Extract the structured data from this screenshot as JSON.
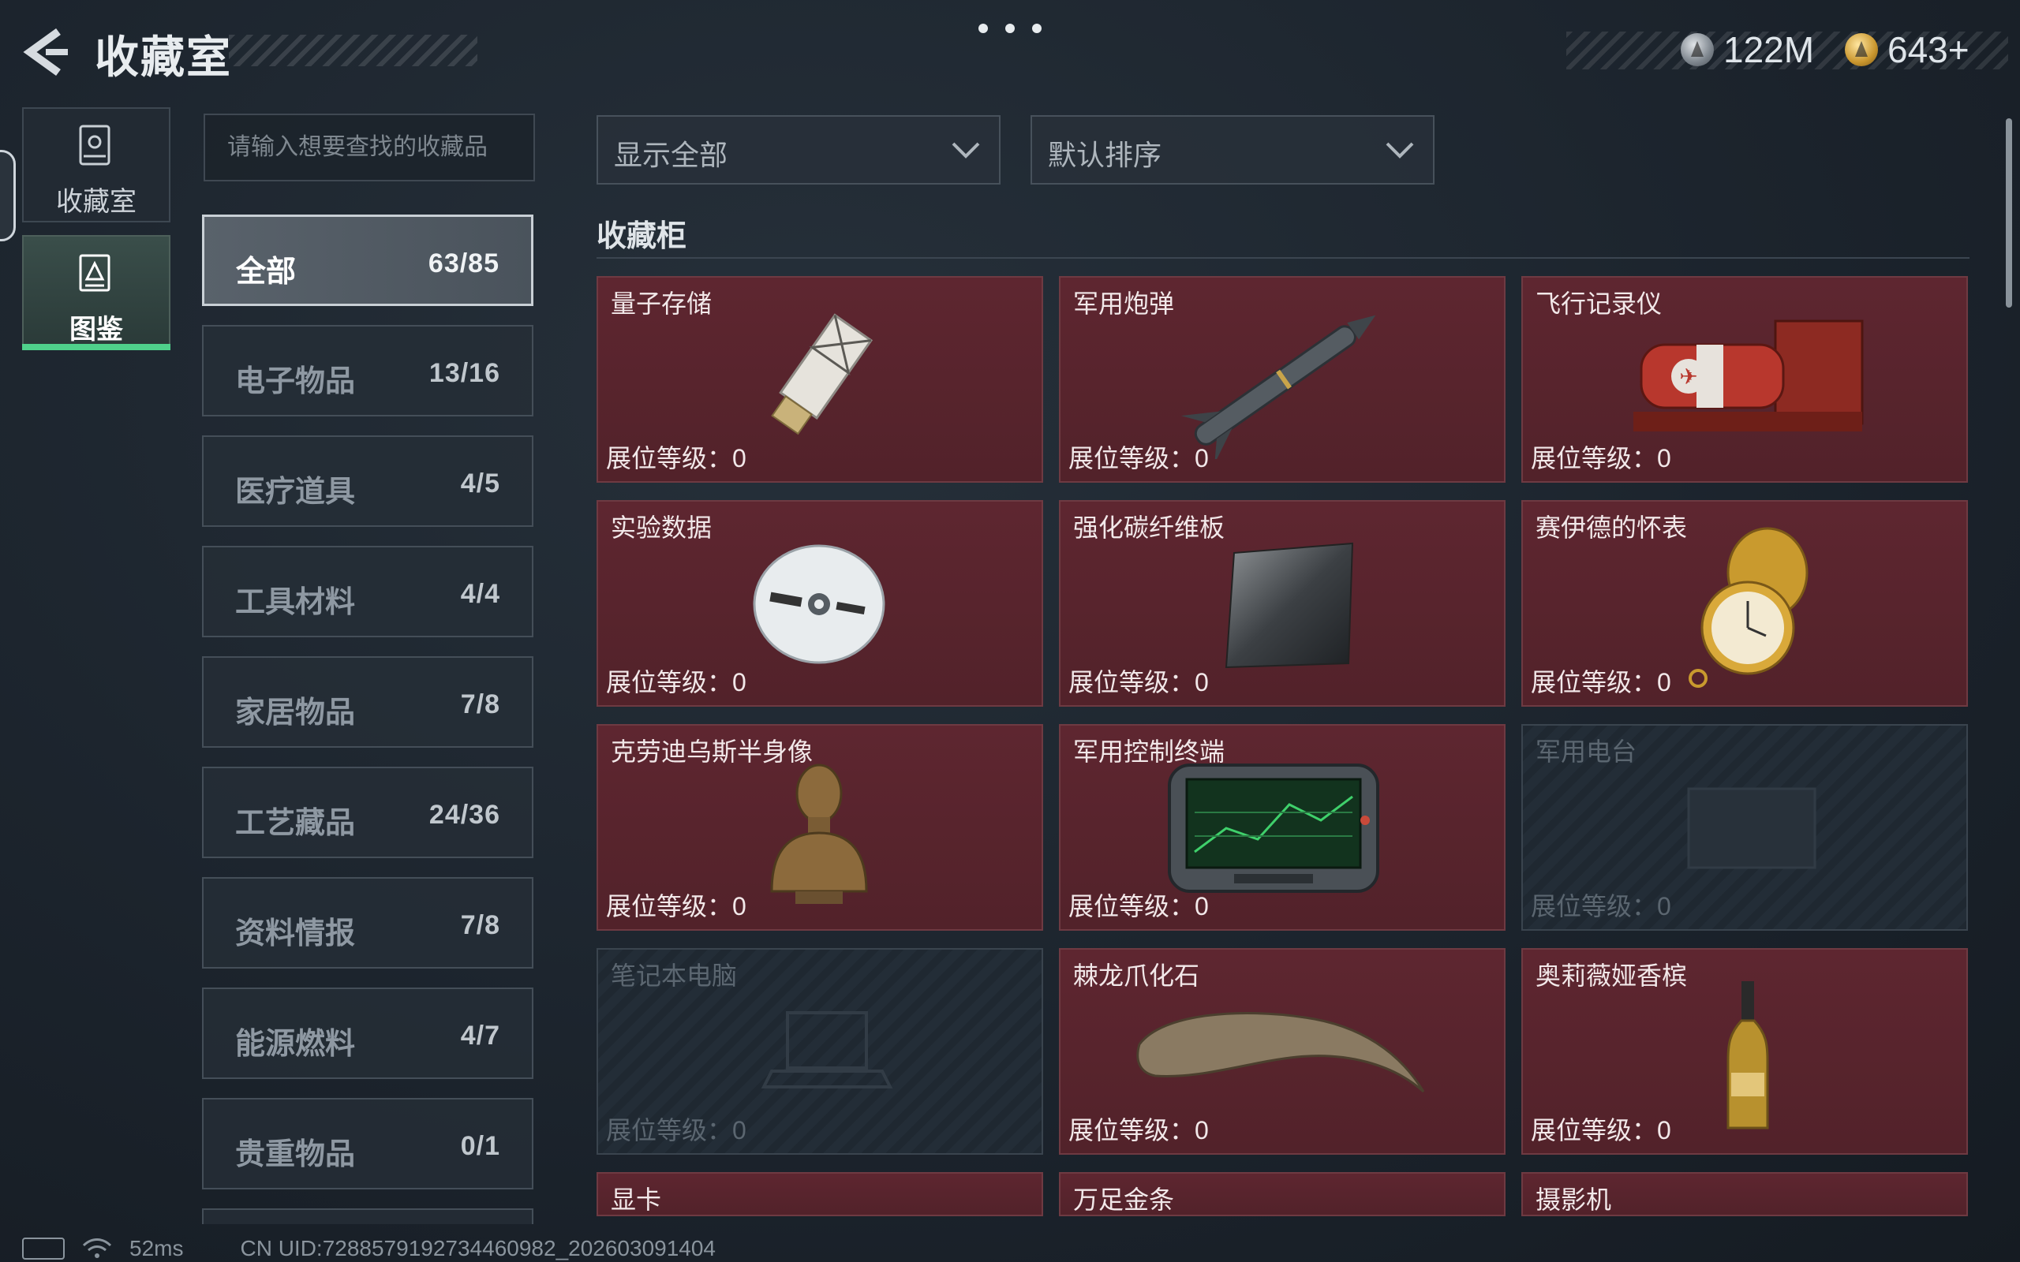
{
  "header": {
    "title": "收藏室"
  },
  "currency": {
    "silver": "122M",
    "gold": "643+"
  },
  "left_nav": [
    {
      "label": "收藏室",
      "active": false
    },
    {
      "label": "图鉴",
      "active": true
    }
  ],
  "search": {
    "placeholder": "请输入想要查找的收藏品"
  },
  "filters": {
    "display": "显示全部",
    "sort": "默认排序"
  },
  "categories": [
    {
      "name": "全部",
      "count": "63/85",
      "active": true
    },
    {
      "name": "电子物品",
      "count": "13/16"
    },
    {
      "name": "医疗道具",
      "count": "4/5"
    },
    {
      "name": "工具材料",
      "count": "4/4"
    },
    {
      "name": "家居物品",
      "count": "7/8"
    },
    {
      "name": "工艺藏品",
      "count": "24/36"
    },
    {
      "name": "资料情报",
      "count": "7/8"
    },
    {
      "name": "能源燃料",
      "count": "4/7"
    },
    {
      "name": "贵重物品",
      "count": "0/1"
    }
  ],
  "cabinet": {
    "title": "收藏柜",
    "items": [
      {
        "name": "量子存储",
        "level": "展位等级：0",
        "unlocked": true,
        "icon": "usb-drive-icon"
      },
      {
        "name": "军用炮弹",
        "level": "展位等级：0",
        "unlocked": true,
        "icon": "missile-icon"
      },
      {
        "name": "飞行记录仪",
        "level": "展位等级：0",
        "unlocked": true,
        "icon": "flight-recorder-icon"
      },
      {
        "name": "实验数据",
        "level": "展位等级：0",
        "unlocked": true,
        "icon": "disc-icon"
      },
      {
        "name": "强化碳纤维板",
        "level": "展位等级：0",
        "unlocked": true,
        "icon": "carbon-plate-icon"
      },
      {
        "name": "赛伊德的怀表",
        "level": "展位等级：0",
        "unlocked": true,
        "icon": "pocket-watch-icon"
      },
      {
        "name": "克劳迪乌斯半身像",
        "level": "展位等级：0",
        "unlocked": true,
        "icon": "bust-statue-icon"
      },
      {
        "name": "军用控制终端",
        "level": "展位等级：0",
        "unlocked": true,
        "icon": "control-terminal-icon"
      },
      {
        "name": "军用电台",
        "level": "展位等级：0",
        "unlocked": false,
        "icon": "radio-icon"
      },
      {
        "name": "笔记本电脑",
        "level": "展位等级：0",
        "unlocked": false,
        "icon": "laptop-icon"
      },
      {
        "name": "棘龙爪化石",
        "level": "展位等级：0",
        "unlocked": true,
        "icon": "claw-fossil-icon"
      },
      {
        "name": "奥莉薇娅香槟",
        "level": "展位等级：0",
        "unlocked": true,
        "icon": "champagne-bottle-icon"
      },
      {
        "name": "显卡",
        "unlocked": true
      },
      {
        "name": "万足金条",
        "unlocked": true
      },
      {
        "name": "摄影机",
        "unlocked": true
      }
    ]
  },
  "status": {
    "ping": "52ms",
    "uid": "CN UID:7288579192734460982_202603091404"
  },
  "colors": {
    "card_bg": "#5e2630",
    "accent_green": "#4fd18b",
    "locked_bg": "#1f2831"
  }
}
